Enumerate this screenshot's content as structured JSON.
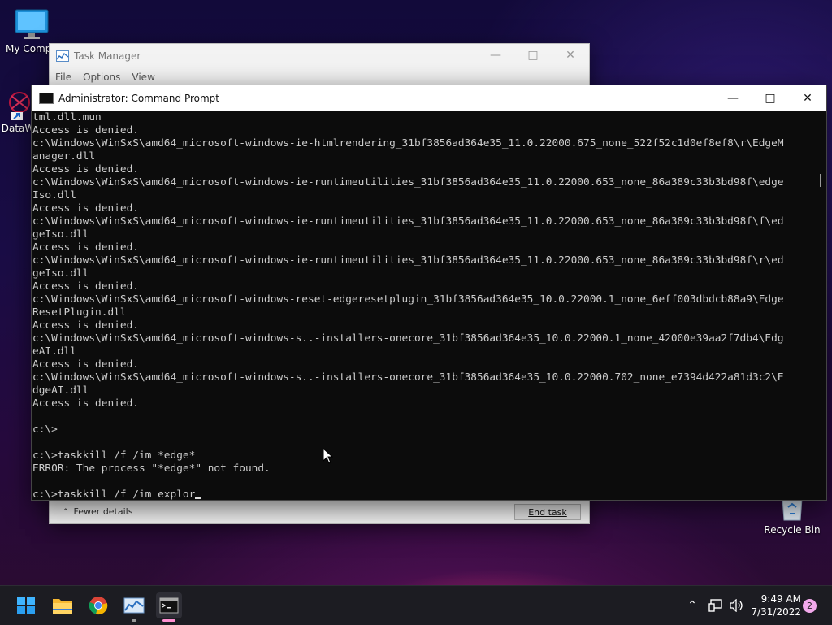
{
  "desktop": {
    "icons": [
      {
        "label": "My Compu"
      },
      {
        "label": "DataW"
      },
      {
        "label": "Recycle Bin"
      }
    ]
  },
  "task_manager": {
    "title": "Task Manager",
    "menu": [
      "File",
      "Options",
      "View"
    ],
    "fewer_details": "Fewer details",
    "end_task": "End task"
  },
  "cmd": {
    "title": "Administrator: Command Prompt",
    "lines": [
      "tml.dll.mun",
      "Access is denied.",
      "c:\\Windows\\WinSxS\\amd64_microsoft-windows-ie-htmlrendering_31bf3856ad364e35_11.0.22000.675_none_522f52c1d0ef8ef8\\r\\EdgeM",
      "anager.dll",
      "Access is denied.",
      "c:\\Windows\\WinSxS\\amd64_microsoft-windows-ie-runtimeutilities_31bf3856ad364e35_11.0.22000.653_none_86a389c33b3bd98f\\edge",
      "Iso.dll",
      "Access is denied.",
      "c:\\Windows\\WinSxS\\amd64_microsoft-windows-ie-runtimeutilities_31bf3856ad364e35_11.0.22000.653_none_86a389c33b3bd98f\\f\\ed",
      "geIso.dll",
      "Access is denied.",
      "c:\\Windows\\WinSxS\\amd64_microsoft-windows-ie-runtimeutilities_31bf3856ad364e35_11.0.22000.653_none_86a389c33b3bd98f\\r\\ed",
      "geIso.dll",
      "Access is denied.",
      "c:\\Windows\\WinSxS\\amd64_microsoft-windows-reset-edgeresetplugin_31bf3856ad364e35_10.0.22000.1_none_6eff003dbdcb88a9\\Edge",
      "ResetPlugin.dll",
      "Access is denied.",
      "c:\\Windows\\WinSxS\\amd64_microsoft-windows-s..-installers-onecore_31bf3856ad364e35_10.0.22000.1_none_42000e39aa2f7db4\\Edg",
      "eAI.dll",
      "Access is denied.",
      "c:\\Windows\\WinSxS\\amd64_microsoft-windows-s..-installers-onecore_31bf3856ad364e35_10.0.22000.702_none_e7394d422a81d3c2\\E",
      "dgeAI.dll",
      "Access is denied.",
      "",
      "c:\\>",
      "",
      "c:\\>taskkill /f /im *edge*",
      "ERROR: The process \"*edge*\" not found.",
      ""
    ],
    "input_line": "c:\\>taskkill /f /im explor"
  },
  "taskbar": {
    "icons": [
      "start-icon",
      "file-explorer-icon",
      "chrome-icon",
      "task-manager-icon",
      "command-prompt-icon"
    ],
    "time": "9:49 AM",
    "date": "7/31/2022",
    "notifications": "2"
  }
}
